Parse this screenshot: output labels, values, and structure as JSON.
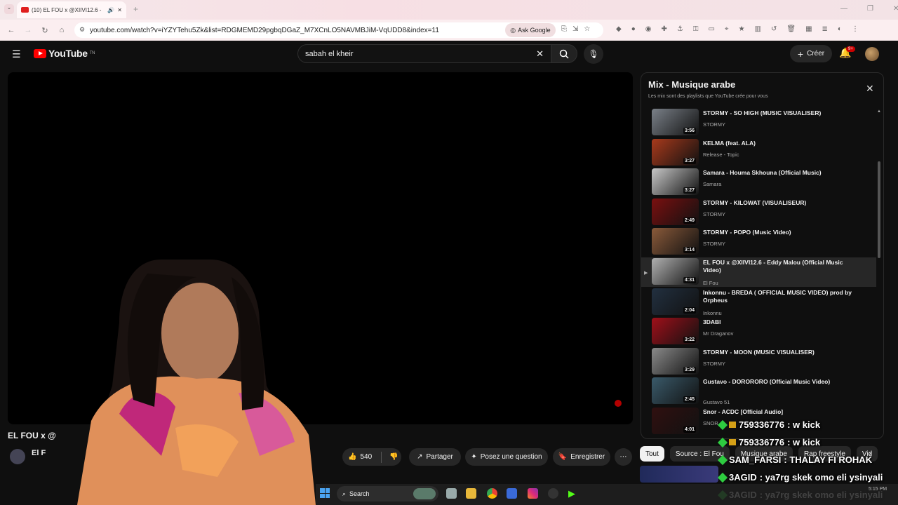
{
  "browser": {
    "tab_title": "(10) EL FOU x @XIIVI12.6 -",
    "url": "youtube.com/watch?v=iYZYTehu5Zk&list=RDGMEMD29pgbqDGaZ_M7XCnLO5NAVMBJiM-VqUDD8&index=11",
    "ask_google": "Ask Google"
  },
  "header": {
    "logo": "YouTube",
    "logo_sup": "TN",
    "search_value": "sabah el kheir",
    "create": "Créer",
    "notif_count": "9+"
  },
  "video": {
    "title_partial": "EL FOU x @",
    "channel_partial": "El F",
    "likes": "540",
    "share": "Partager",
    "ask": "Posez une question",
    "save": "Enregistrer"
  },
  "playlist": {
    "title": "Mix - Musique arabe",
    "subtitle": "Les mix sont des playlists que YouTube crée pour vous",
    "items": [
      {
        "title": "STORMY - SO HIGH (MUSIC VISUALISER)",
        "channel": "STORMY",
        "duration": "3:56",
        "color": "#7a8088"
      },
      {
        "title": "KELMA (feat. ALA)",
        "channel": "Release - Topic",
        "duration": "3:27",
        "color": "#a83a1c"
      },
      {
        "title": "Samara - Houma Skhouna (Official Music)",
        "channel": "Samara",
        "duration": "3:27",
        "color": "#c8c8c8"
      },
      {
        "title": "STORMY - KILOWAT (VISUALISEUR)",
        "channel": "STORMY",
        "duration": "2:49",
        "color": "#7a1010"
      },
      {
        "title": "STORMY - POPO (Music Video)",
        "channel": "STORMY",
        "duration": "3:14",
        "color": "#8a5a3a"
      },
      {
        "title": "EL FOU x @XIIVI12.6 - Eddy Malou (Official Music Video)",
        "channel": "El Fou",
        "duration": "4:31",
        "color": "#b0b0b0",
        "active": true
      },
      {
        "title": "Inkonnu - BREDA ( OFFICIAL MUSIC VIDEO) prod by Orpheus",
        "channel": "Inkonnu",
        "duration": "2:04",
        "color": "#223040"
      },
      {
        "title": "3DABI",
        "channel": "Mr Draganov",
        "duration": "3:22",
        "color": "#a0101a"
      },
      {
        "title": "STORMY - MOON (MUSIC VISUALISER)",
        "channel": "STORMY",
        "duration": "3:29",
        "color": "#8a8a8a"
      },
      {
        "title": "Gustavo - DORORORO (Official Music Video)",
        "channel": "Gustavo 51",
        "duration": "2:45",
        "color": "#3a5a6a"
      },
      {
        "title": "Snor - ACDC [Official Audio]",
        "channel": "SNOR",
        "duration": "4:01",
        "color": "#301010"
      }
    ]
  },
  "chips": [
    "Tout",
    "Source : El Fou",
    "Musique arabe",
    "Rap freestyle",
    "Vid"
  ],
  "chat": [
    {
      "user": "759336776",
      "msg": ": w kick"
    },
    {
      "user": "759336776",
      "msg": ": w kick"
    },
    {
      "user": "SAM_FARSI",
      "msg": ": THALAY FI ROHAK"
    },
    {
      "user": "3AGID",
      "msg": ": ya7rg skek omo eli ysinyali"
    },
    {
      "user": "3AGID",
      "msg": ": ya7rg skek omo eli ysinyali"
    }
  ],
  "taskbar": {
    "search": "Search",
    "time": "5:15 PM"
  }
}
